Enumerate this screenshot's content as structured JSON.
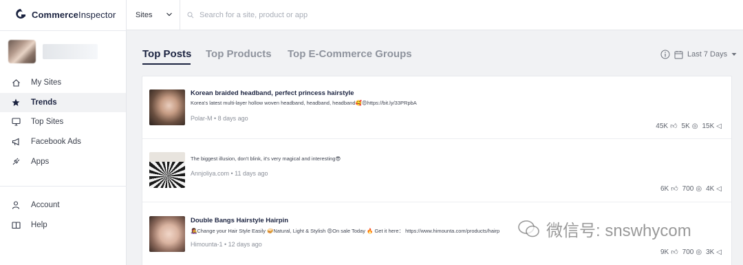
{
  "brand": {
    "name_bold": "Commerce",
    "name_light": "Inspector"
  },
  "sidebar": {
    "items": [
      {
        "label": "My Sites",
        "icon": "home-icon"
      },
      {
        "label": "Trends",
        "icon": "star-icon"
      },
      {
        "label": "Top Sites",
        "icon": "monitor-icon"
      },
      {
        "label": "Facebook Ads",
        "icon": "megaphone-icon"
      },
      {
        "label": "Apps",
        "icon": "plug-icon"
      }
    ],
    "bottom_items": [
      {
        "label": "Account",
        "icon": "user-icon"
      },
      {
        "label": "Help",
        "icon": "book-icon"
      }
    ]
  },
  "topbar": {
    "site_select": "Sites",
    "search_placeholder": "Search for a site, product or app"
  },
  "tabs": [
    "Top Posts",
    "Top Products",
    "Top E-Commerce Groups"
  ],
  "date_range": "Last 7 Days",
  "posts": [
    {
      "title": "Korean braided headband, perfect princess hairstyle",
      "desc": "Korea's latest multi-layer hollow woven headband, headband, headband🥰😍https://bit.ly/33PRpbA",
      "meta": "Polar-M • 8 days ago",
      "likes": "45K",
      "comments": "5K",
      "shares": "15K"
    },
    {
      "title": "",
      "desc": "The biggest illusion, don't blink, it's very magical and interesting😎",
      "meta": "Annjoliya.com • 11 days ago",
      "likes": "6K",
      "comments": "700",
      "shares": "4K"
    },
    {
      "title": "Double Bangs Hairstyle Hairpin",
      "desc": "👩‍🎤Change your Hair Style Easily 🥪Natural, Light & Stylish 😍On sale Today 🔥 Get it here： https://www.himounta.com/products/hairp",
      "meta": "Himounta-1 • 12 days ago",
      "likes": "9K",
      "comments": "700",
      "shares": "3K"
    }
  ],
  "watermark": "微信号: snswhycom",
  "colors": {
    "accent": "#1b2340",
    "active_bg": "#f1f2f4"
  }
}
